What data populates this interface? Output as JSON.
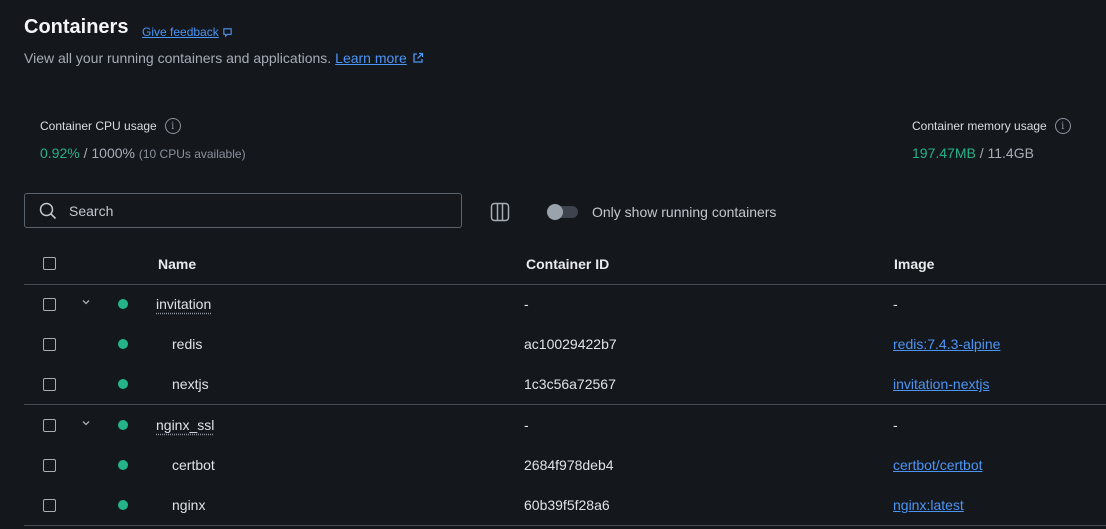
{
  "header": {
    "title": "Containers",
    "feedback_label": "Give feedback",
    "subtitle": "View all your running containers and applications.",
    "learn_more": "Learn more"
  },
  "stats": {
    "cpu": {
      "label": "Container CPU usage",
      "value": "0.92%",
      "separator": " / ",
      "total": "1000%",
      "detail": "(10 CPUs available)"
    },
    "memory": {
      "label": "Container memory usage",
      "value": "197.47MB",
      "separator": " / ",
      "total": "11.4GB"
    }
  },
  "toolbar": {
    "search_placeholder": "Search",
    "toggle_label": "Only show running containers"
  },
  "table": {
    "columns": [
      "Name",
      "Container ID",
      "Image"
    ],
    "rows": [
      {
        "name": "invitation",
        "id": "-",
        "image": "-"
      },
      {
        "name": "redis",
        "id": "ac10029422b7",
        "image": "redis:7.4.3-alpine"
      },
      {
        "name": "nextjs",
        "id": "1c3c56a72567",
        "image": "invitation-nextjs"
      },
      {
        "name": "nginx_ssl",
        "id": "-",
        "image": "-"
      },
      {
        "name": "certbot",
        "id": "2684f978deb4",
        "image": "certbot/certbot"
      },
      {
        "name": "nginx",
        "id": "60b39f5f28a6",
        "image": "nginx:latest"
      }
    ]
  },
  "colors": {
    "accent_green": "#25b38a",
    "link_blue": "#4c95f5",
    "background": "#14171c"
  }
}
